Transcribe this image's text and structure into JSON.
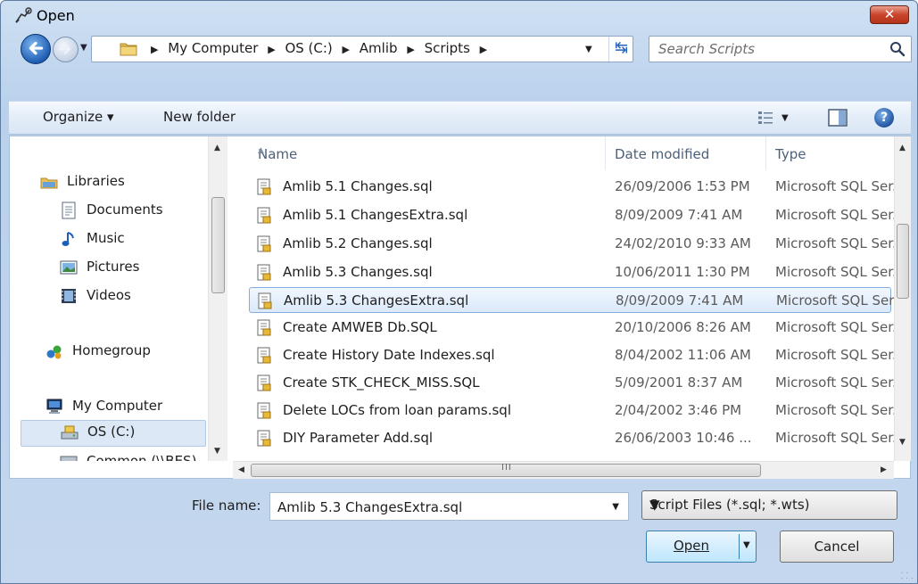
{
  "window": {
    "title": "Open",
    "close_label": "✕"
  },
  "address": {
    "crumbs": [
      "My Computer",
      "OS (C:)",
      "Amlib",
      "Scripts"
    ],
    "search_placeholder": "Search Scripts"
  },
  "toolbar": {
    "organize_label": "Organize ▾",
    "new_folder_label": "New folder",
    "help_label": "?"
  },
  "nav": {
    "items": [
      {
        "label": "Libraries",
        "icon": "libraries-icon"
      },
      {
        "label": "Documents",
        "icon": "documents-icon"
      },
      {
        "label": "Music",
        "icon": "music-icon"
      },
      {
        "label": "Pictures",
        "icon": "pictures-icon"
      },
      {
        "label": "Videos",
        "icon": "videos-icon"
      },
      {
        "label": "Homegroup",
        "icon": "homegroup-icon"
      },
      {
        "label": "My Computer",
        "icon": "computer-icon"
      },
      {
        "label": "OS (C:)",
        "icon": "drive-icon",
        "selected": true
      },
      {
        "label": "Common (\\\\BES)",
        "icon": "network-drive-icon"
      }
    ]
  },
  "file_list": {
    "columns": [
      "Name",
      "Date modified",
      "Type"
    ],
    "rows": [
      {
        "name": "Amlib 5.1 Changes.sql",
        "date": "26/09/2006 1:53 PM",
        "type": "Microsoft SQL Ser."
      },
      {
        "name": "Amlib 5.1 ChangesExtra.sql",
        "date": "8/09/2009 7:41 AM",
        "type": "Microsoft SQL Ser."
      },
      {
        "name": "Amlib 5.2 Changes.sql",
        "date": "24/02/2010 9:33 AM",
        "type": "Microsoft SQL Ser."
      },
      {
        "name": "Amlib 5.3 Changes.sql",
        "date": "10/06/2011 1:30 PM",
        "type": "Microsoft SQL Ser."
      },
      {
        "name": "Amlib 5.3 ChangesExtra.sql",
        "date": "8/09/2009 7:41 AM",
        "type": "Microsoft SQL Ser.",
        "selected": true
      },
      {
        "name": "Create AMWEB Db.SQL",
        "date": "20/10/2006 8:26 AM",
        "type": "Microsoft SQL Ser."
      },
      {
        "name": "Create History Date Indexes.sql",
        "date": "8/04/2002 11:06 AM",
        "type": "Microsoft SQL Ser."
      },
      {
        "name": "Create STK_CHECK_MISS.SQL",
        "date": "5/09/2001 8:37 AM",
        "type": "Microsoft SQL Ser."
      },
      {
        "name": "Delete LOCs from loan params.sql",
        "date": "2/04/2002 3:46 PM",
        "type": "Microsoft SQL Ser."
      },
      {
        "name": "DIY Parameter Add.sql",
        "date": "26/06/2003 10:46 ...",
        "type": "Microsoft SQL Ser."
      }
    ]
  },
  "bottom": {
    "file_name_label": "File name:",
    "file_name_value": "Amlib 5.3 ChangesExtra.sql",
    "filter_value": "Script Files (*.sql; *.wts)",
    "open_label": "Open",
    "cancel_label": "Cancel"
  }
}
